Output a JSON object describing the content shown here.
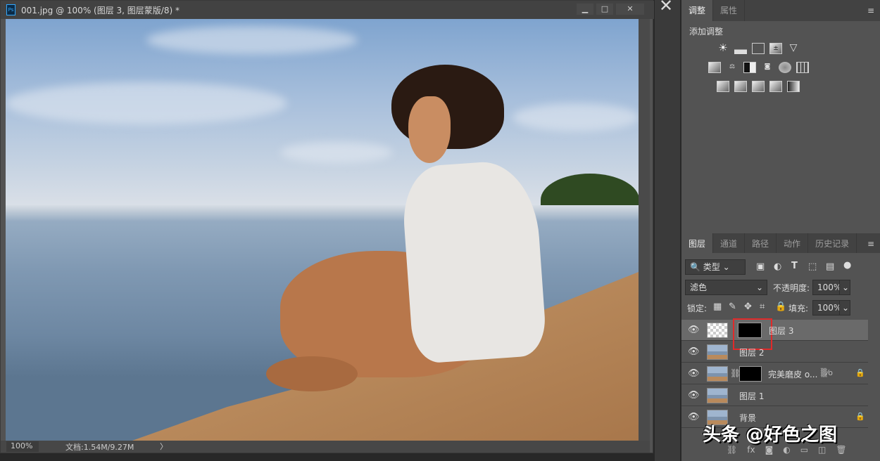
{
  "document": {
    "title": "001.jpg @ 100% (图层 3, 图层蒙版/8) *",
    "app_icon": "Ps",
    "window_buttons": [
      "minimize",
      "restore",
      "close"
    ],
    "zoom": "100%",
    "doc_info": "文档:1.54M/9.27M",
    "status_arrow": "〉"
  },
  "adjust_panel": {
    "tabs": [
      "调整",
      "属性"
    ],
    "active_tab": "调整",
    "heading": "添加调整",
    "icons_row1": [
      "brightness-contrast",
      "levels",
      "curves",
      "exposure",
      "vibrance"
    ],
    "icons_row2": [
      "hue-saturation",
      "color-balance",
      "black-white",
      "photo-filter",
      "channel-mixer",
      "color-lookup"
    ],
    "icons_row3": [
      "invert",
      "posterize",
      "threshold",
      "selective-color",
      "gradient-map"
    ]
  },
  "layers_panel": {
    "tabs": [
      "图层",
      "通道",
      "路径",
      "动作",
      "历史记录"
    ],
    "active_tab": "图层",
    "filter": "类型",
    "blend_mode": "滤色",
    "opacity_label": "不透明度:",
    "opacity": "100%",
    "lock_label": "锁定:",
    "fill_label": "填充:",
    "fill": "100%",
    "layers": [
      {
        "name": "图层 3",
        "selected": true,
        "has_mask": true,
        "locked": false
      },
      {
        "name": "图层 2",
        "selected": false,
        "has_mask": false,
        "locked": false
      },
      {
        "name": "完美磨皮 o...",
        "selected": false,
        "has_mask": true,
        "locked": true
      },
      {
        "name": "图层 1",
        "selected": false,
        "has_mask": false,
        "locked": false
      },
      {
        "name": "背景",
        "selected": false,
        "has_mask": false,
        "locked": true
      }
    ]
  },
  "watermark": "头条 @好色之图",
  "colors": {
    "highlight": "#e02a2a",
    "panel": "#535353"
  }
}
